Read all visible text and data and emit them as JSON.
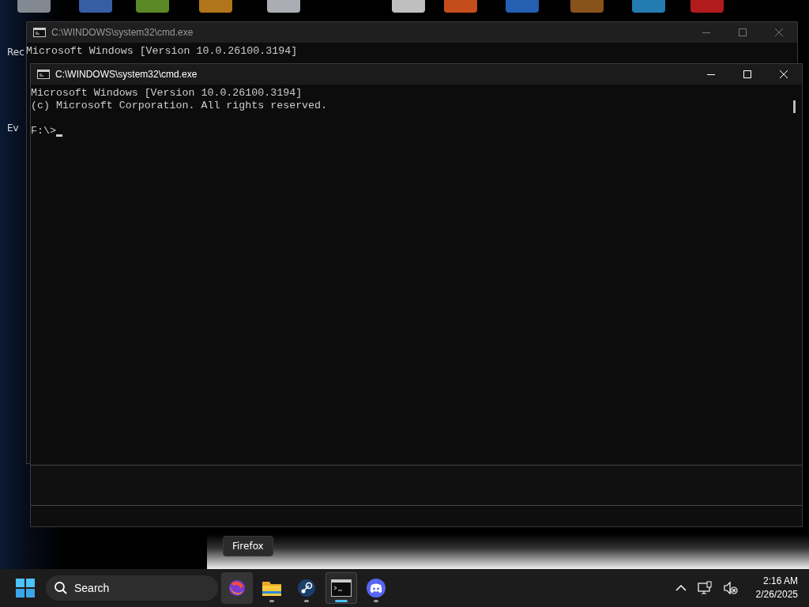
{
  "desktop": {
    "labels": [
      "Rec",
      "Ev"
    ]
  },
  "windows": [
    {
      "title": "C:\\WINDOWS\\system32\\cmd.exe",
      "active": false,
      "lines": [
        "Microsoft Windows [Version 10.0.26100.3194]"
      ]
    },
    {
      "title": "C:\\WINDOWS\\system32\\cmd.exe",
      "active": true,
      "lines": [
        "Microsoft Windows [Version 10.0.26100.3194]",
        "(c) Microsoft Corporation. All rights reserved."
      ],
      "prompt": "F:\\>"
    }
  ],
  "tooltip": "Firefox",
  "taskbar": {
    "search": {
      "placeholder": "Search"
    },
    "apps": [
      {
        "kind": "firefox",
        "running": false,
        "selected": false,
        "hovered": true
      },
      {
        "kind": "explorer",
        "running": true,
        "selected": false
      },
      {
        "kind": "steam",
        "running": true,
        "selected": false
      },
      {
        "kind": "terminal",
        "running": true,
        "selected": true
      },
      {
        "kind": "discord",
        "running": true,
        "selected": false
      }
    ],
    "time": "2:16 AM",
    "date": "2/26/2025"
  }
}
